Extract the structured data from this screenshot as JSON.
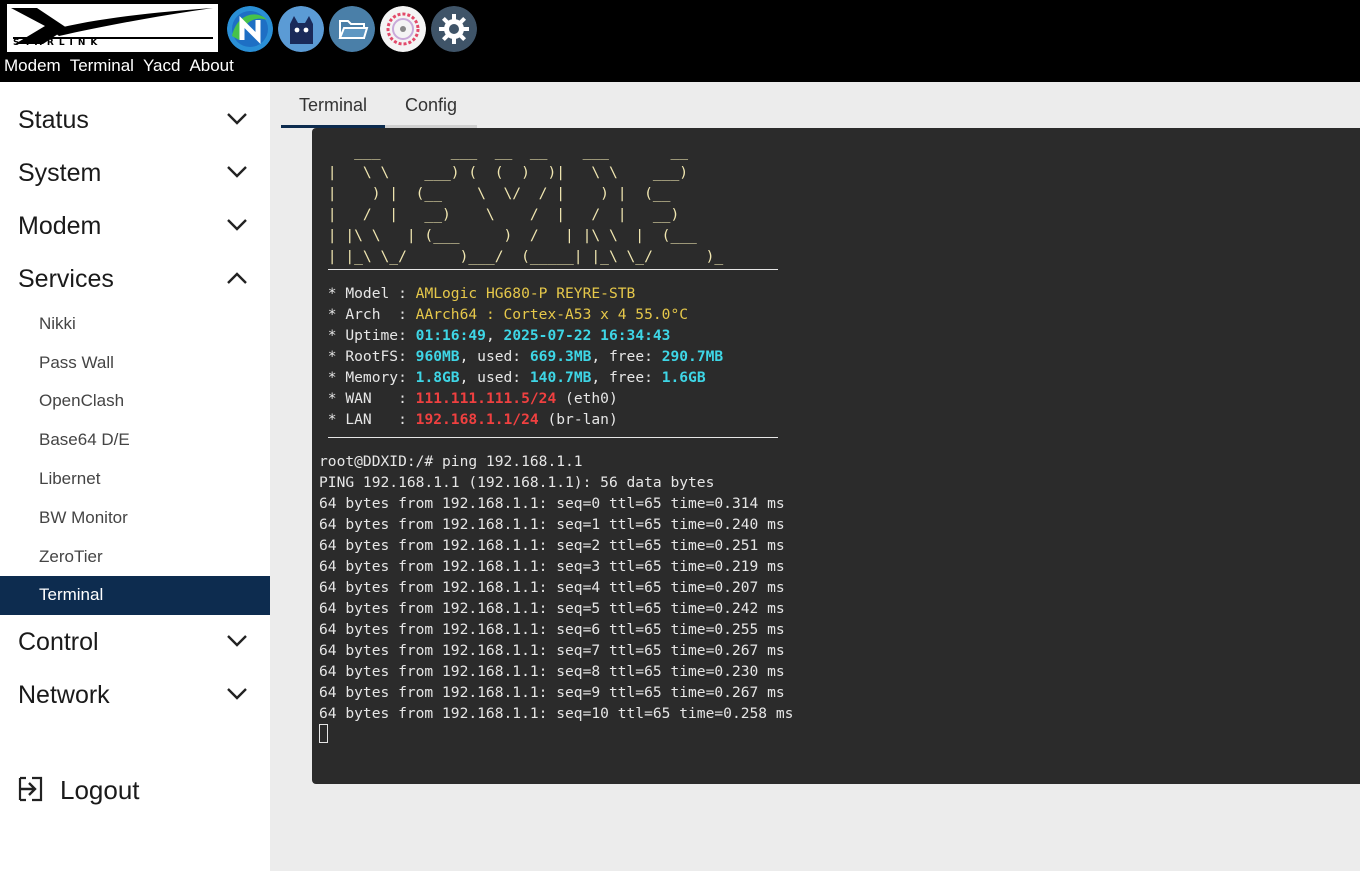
{
  "header": {
    "logo_text": "STARLINK",
    "nav": [
      "Modem",
      "Terminal",
      "Yacd",
      "About"
    ],
    "icons": [
      "nikki-icon",
      "openclash-cat-icon",
      "folder-icon",
      "gauge-icon",
      "gear-icon"
    ]
  },
  "sidebar": {
    "sections": [
      {
        "label": "Status",
        "expanded": false
      },
      {
        "label": "System",
        "expanded": false
      },
      {
        "label": "Modem",
        "expanded": false
      },
      {
        "label": "Services",
        "expanded": true
      },
      {
        "label": "Control",
        "expanded": false
      },
      {
        "label": "Network",
        "expanded": false
      }
    ],
    "services_items": [
      "Nikki",
      "Pass Wall",
      "OpenClash",
      "Base64 D/E",
      "Libernet",
      "BW Monitor",
      "ZeroTier",
      "Terminal"
    ],
    "active_item": "Terminal",
    "logout": "Logout"
  },
  "tabs": [
    {
      "label": "Terminal",
      "active": true
    },
    {
      "label": "Config",
      "active": false
    }
  ],
  "terminal": {
    "banner": [
      "    ___        ___  __  __    ___       __",
      " |   \\ \\    ___) (  (  )  )|   \\ \\    ___)",
      " |    ) |  (__    \\  \\/  / |    ) |  (__",
      " |   /  |   __)    \\    /  |   /  |   __)",
      " | |\\ \\   | (___     )  /   | |\\ \\  |  (___",
      " | |_\\ \\_/      )___/  (_____| |_\\ \\_/      )_"
    ],
    "info": {
      "model_label": " * Model : ",
      "model": "AMLogic HG680-P REYRE-STB",
      "arch_label": " * Arch  : ",
      "arch": "AArch64 : Cortex-A53 x 4 55.0°C",
      "uptime_label": " * Uptime: ",
      "uptime_time": "01:16:49",
      "uptime_sep": ", ",
      "uptime_date": "2025-07-22 16:34:43",
      "rootfs_label": " * RootFS: ",
      "rootfs_total": "960MB",
      "rootfs_used_label": ", used: ",
      "rootfs_used": "669.3MB",
      "rootfs_free_label": ", free: ",
      "rootfs_free": "290.7MB",
      "memory_label": " * Memory: ",
      "memory_total": "1.8GB",
      "memory_used_label": ", used: ",
      "memory_used": "140.7MB",
      "memory_free_label": ", free: ",
      "memory_free": "1.6GB",
      "wan_label": " * WAN   : ",
      "wan_ip": "111.111.111.5/24",
      "wan_if": " (eth0)",
      "lan_label": " * LAN   : ",
      "lan_ip": "192.168.1.1/24",
      "lan_if": " (br-lan)"
    },
    "output": [
      "root@DDXID:/# ping 192.168.1.1",
      "PING 192.168.1.1 (192.168.1.1): 56 data bytes",
      "64 bytes from 192.168.1.1: seq=0 ttl=65 time=0.314 ms",
      "64 bytes from 192.168.1.1: seq=1 ttl=65 time=0.240 ms",
      "64 bytes from 192.168.1.1: seq=2 ttl=65 time=0.251 ms",
      "64 bytes from 192.168.1.1: seq=3 ttl=65 time=0.219 ms",
      "64 bytes from 192.168.1.1: seq=4 ttl=65 time=0.207 ms",
      "64 bytes from 192.168.1.1: seq=5 ttl=65 time=0.242 ms",
      "64 bytes from 192.168.1.1: seq=6 ttl=65 time=0.255 ms",
      "64 bytes from 192.168.1.1: seq=7 ttl=65 time=0.267 ms",
      "64 bytes from 192.168.1.1: seq=8 ttl=65 time=0.230 ms",
      "64 bytes from 192.168.1.1: seq=9 ttl=65 time=0.267 ms",
      "64 bytes from 192.168.1.1: seq=10 ttl=65 time=0.258 ms"
    ]
  },
  "colors": {
    "header_bg": "#000000",
    "active_bg": "#0d2c4f",
    "terminal_bg": "#2b2b2b",
    "yellow": "#e6c84a",
    "cyan": "#3ed6e6",
    "red": "#f04040"
  }
}
